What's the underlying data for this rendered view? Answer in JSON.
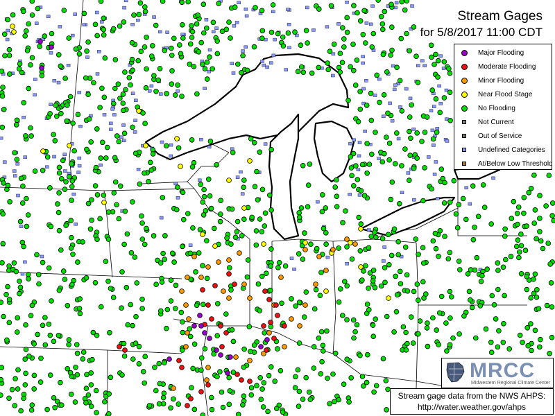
{
  "title": "Stream Gages",
  "subtitle": "for 5/8/2017 11:00 CDT",
  "legend": [
    {
      "label": "Major Flooding",
      "shape": "dot",
      "color": "#9900cc",
      "icon": "major-flooding-icon"
    },
    {
      "label": "Moderate Flooding",
      "shape": "dot",
      "color": "#ee1111",
      "icon": "moderate-flooding-icon"
    },
    {
      "label": "Minor Flooding",
      "shape": "dot",
      "color": "#ff9900",
      "icon": "minor-flooding-icon"
    },
    {
      "label": "Near Flood Stage",
      "shape": "dot",
      "color": "#ffff00",
      "icon": "near-flood-stage-icon"
    },
    {
      "label": "No Flooding",
      "shape": "dot",
      "color": "#00dd00",
      "icon": "no-flooding-icon"
    },
    {
      "label": "Not Current",
      "shape": "square",
      "color": "#888888",
      "icon": "not-current-icon"
    },
    {
      "label": "Out of Service",
      "shape": "square",
      "color": "#777766",
      "icon": "out-of-service-icon"
    },
    {
      "label": "Undefined Categories",
      "shape": "square",
      "color": "#8899ff",
      "icon": "undefined-categories-icon"
    },
    {
      "label": "At/Below Low Threshold",
      "shape": "square",
      "color": "#aa7733",
      "icon": "below-threshold-icon"
    }
  ],
  "logo": {
    "name": "MRCC",
    "subtitle": "Midwestern Regional Climate Center"
  },
  "source": {
    "line1": "Stream gage data from the NWS AHPS:",
    "line2": "http://water.weather.gov/ahps"
  },
  "colors": {
    "major": "#9900cc",
    "moderate": "#ee1111",
    "minor": "#ff9900",
    "near": "#ffff00",
    "none": "#00dd00",
    "undefined": "#8899ff",
    "lake": "#ffffff",
    "border": "#000000"
  }
}
